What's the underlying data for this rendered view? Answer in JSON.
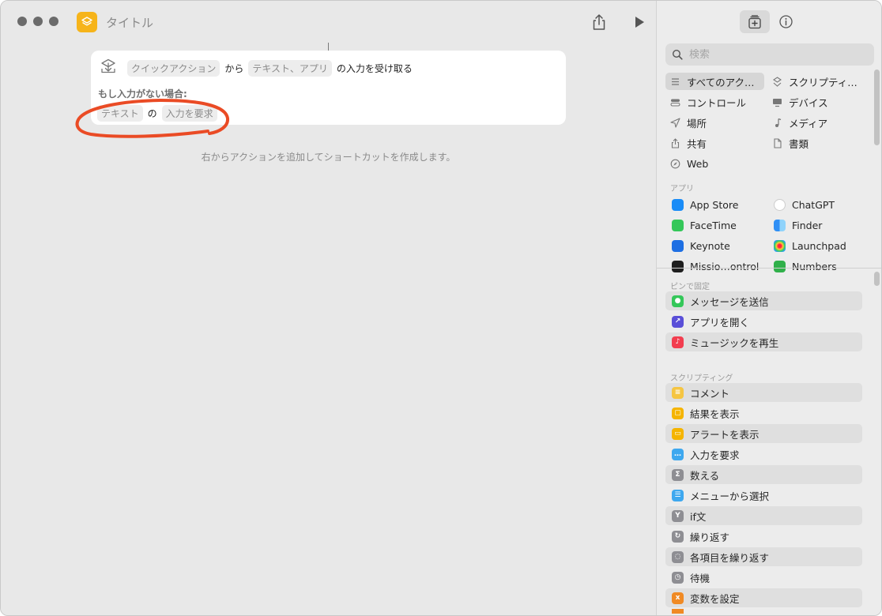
{
  "window": {
    "title": "タイトル"
  },
  "editor": {
    "action": {
      "tokens": [
        "クイックアクション",
        "テキスト、アプリ"
      ],
      "from_word": "から",
      "tail": "の入力を受け取る",
      "if_none_label": "もし入力がない場合:",
      "fallback_token": "テキスト",
      "fallback_no": "の",
      "fallback_action": "入力を要求"
    },
    "hint": "右からアクションを追加してショートカットを作成します。"
  },
  "library": {
    "search_placeholder": "検索",
    "categories": [
      {
        "label": "すべてのアク…",
        "icon": "list-icon"
      },
      {
        "label": "スクリプティ…",
        "icon": "scripting-icon"
      },
      {
        "label": "コントロール",
        "icon": "toggle-icon"
      },
      {
        "label": "デバイス",
        "icon": "device-icon"
      },
      {
        "label": "場所",
        "icon": "location-icon"
      },
      {
        "label": "メディア",
        "icon": "music-icon"
      },
      {
        "label": "共有",
        "icon": "share-icon"
      },
      {
        "label": "書類",
        "icon": "document-icon"
      },
      {
        "label": "Web",
        "icon": "compass-icon"
      }
    ],
    "apps_heading": "アプリ",
    "apps": [
      {
        "label": "App Store",
        "color": "#1a8cf7"
      },
      {
        "label": "ChatGPT",
        "color": "#ffffff"
      },
      {
        "label": "FaceTime",
        "color": "#34c759"
      },
      {
        "label": "Finder",
        "color": "#2f8ff5"
      },
      {
        "label": "Keynote",
        "color": "#1e6fe3"
      },
      {
        "label": "Launchpad",
        "color": "#e9e9e9"
      },
      {
        "label": "Missio…ontrol",
        "color": "#1f1f1f"
      },
      {
        "label": "Numbers",
        "color": "#30b04a"
      }
    ],
    "pinned_heading": "ピンで固定",
    "pinned": [
      {
        "label": "メッセージを送信",
        "color": "#34c759",
        "glyph": "●"
      },
      {
        "label": "アプリを開く",
        "color": "#5a4fd8",
        "glyph": "↗"
      },
      {
        "label": "ミュージックを再生",
        "color": "#f23d4f",
        "glyph": "♪"
      }
    ],
    "scripting_heading": "スクリプティング",
    "scripting": [
      {
        "label": "コメント",
        "color": "#f5c542",
        "glyph": "≡"
      },
      {
        "label": "結果を表示",
        "color": "#f5b400",
        "glyph": "▢"
      },
      {
        "label": "アラートを表示",
        "color": "#f5b400",
        "glyph": "▭"
      },
      {
        "label": "入力を要求",
        "color": "#3ea8ef",
        "glyph": "…"
      },
      {
        "label": "数える",
        "color": "#8e8e93",
        "glyph": "Σ"
      },
      {
        "label": "メニューから選択",
        "color": "#3ea8ef",
        "glyph": "☰"
      },
      {
        "label": "if文",
        "color": "#8e8e93",
        "glyph": "Y"
      },
      {
        "label": "繰り返す",
        "color": "#8e8e93",
        "glyph": "↻"
      },
      {
        "label": "各項目を繰り返す",
        "color": "#8e8e93",
        "glyph": "◌"
      },
      {
        "label": "待機",
        "color": "#8e8e93",
        "glyph": "◷"
      },
      {
        "label": "変数を設定",
        "color": "#f08a24",
        "glyph": "x"
      }
    ]
  }
}
